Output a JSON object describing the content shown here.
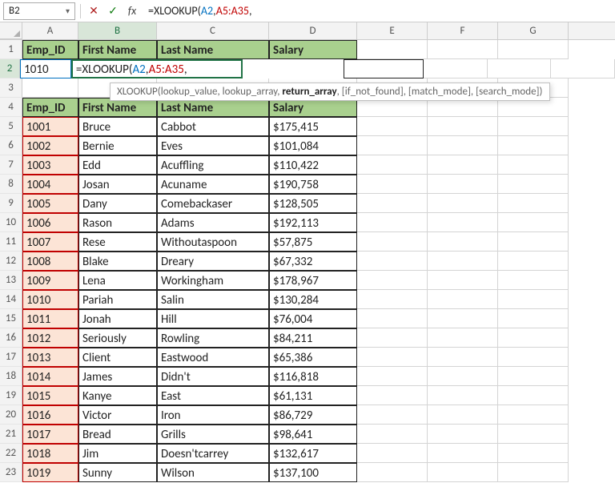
{
  "namebox": "B2",
  "formula_bar": {
    "prefix": "=XLOOKUP(",
    "ref1": "A2",
    "comma1": ",",
    "ref2": "A5:A35",
    "suffix": ","
  },
  "tooltip": {
    "fn": "XLOOKUP(",
    "p1": "lookup_value",
    "p2": "lookup_array",
    "p3": "return_array",
    "rest": ", [if_not_found], [match_mode], [search_mode])"
  },
  "columns": [
    "A",
    "B",
    "C",
    "D",
    "E",
    "F",
    "G"
  ],
  "headers_top": {
    "emp_id": "Emp_ID",
    "first": "First Name",
    "last": "Last Name",
    "salary": "Salary"
  },
  "lookup_row": {
    "id": "1010",
    "formula": "=XLOOKUP(A2,A5:A35,"
  },
  "data": [
    {
      "id": "1001",
      "first": "Bruce",
      "last": "Cabbot",
      "salary": "$175,415"
    },
    {
      "id": "1002",
      "first": "Bernie",
      "last": "Eves",
      "salary": "$101,084"
    },
    {
      "id": "1003",
      "first": "Edd",
      "last": "Acuffling",
      "salary": "$110,422"
    },
    {
      "id": "1004",
      "first": "Josan",
      "last": "Acuname",
      "salary": "$190,758"
    },
    {
      "id": "1005",
      "first": "Dany",
      "last": "Comebackaser",
      "salary": "$128,505"
    },
    {
      "id": "1006",
      "first": "Rason",
      "last": "Adams",
      "salary": "$192,113"
    },
    {
      "id": "1007",
      "first": "Rese",
      "last": "Withoutaspoon",
      "salary": "$57,875"
    },
    {
      "id": "1008",
      "first": "Blake",
      "last": "Dreary",
      "salary": "$67,332"
    },
    {
      "id": "1009",
      "first": "Lena",
      "last": "Workingham",
      "salary": "$178,967"
    },
    {
      "id": "1010",
      "first": "Pariah",
      "last": "Salin",
      "salary": "$130,284"
    },
    {
      "id": "1011",
      "first": "Jonah",
      "last": "Hill",
      "salary": "$76,004"
    },
    {
      "id": "1012",
      "first": "Seriously",
      "last": "Rowling",
      "salary": "$84,211"
    },
    {
      "id": "1013",
      "first": "Client",
      "last": "Eastwood",
      "salary": "$65,386"
    },
    {
      "id": "1014",
      "first": "James",
      "last": "Didn't",
      "salary": "$116,818"
    },
    {
      "id": "1015",
      "first": "Kanye",
      "last": "East",
      "salary": "$61,131"
    },
    {
      "id": "1016",
      "first": "Victor",
      "last": "Iron",
      "salary": "$86,729"
    },
    {
      "id": "1017",
      "first": "Bread",
      "last": "Grills",
      "salary": "$98,641"
    },
    {
      "id": "1018",
      "first": "Jim",
      "last": "Doesn'tcarrey",
      "salary": "$132,617"
    },
    {
      "id": "1019",
      "first": "Sunny",
      "last": "Wilson",
      "salary": "$137,100"
    }
  ]
}
